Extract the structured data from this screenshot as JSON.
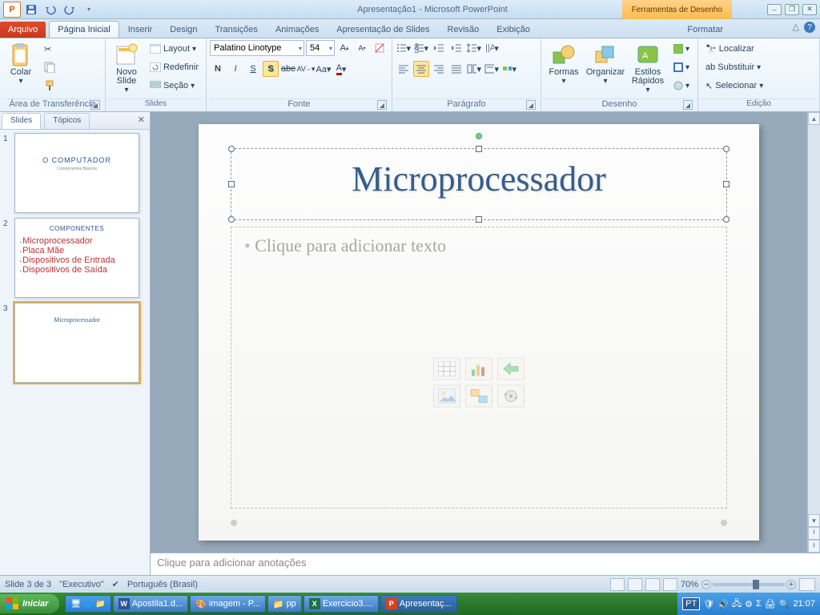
{
  "app": {
    "title": "Apresentação1 - Microsoft PowerPoint",
    "context_tab": "Ferramentas de Desenho",
    "context_subtab": "Formatar"
  },
  "qat": {
    "app_initial": "P"
  },
  "tabs": {
    "file": "Arquivo",
    "items": [
      "Página Inicial",
      "Inserir",
      "Design",
      "Transições",
      "Animações",
      "Apresentação de Slides",
      "Revisão",
      "Exibição"
    ],
    "active": 0
  },
  "ribbon": {
    "clipboard": {
      "label": "Área de Transferência",
      "paste": "Colar"
    },
    "slides": {
      "label": "Slides",
      "new_slide": "Novo Slide",
      "layout": "Layout",
      "reset": "Redefinir",
      "section": "Seção"
    },
    "font": {
      "label": "Fonte",
      "name": "Palatino Linotype",
      "size": "54"
    },
    "paragraph": {
      "label": "Parágrafo"
    },
    "drawing": {
      "label": "Desenho",
      "shapes": "Formas",
      "arrange": "Organizar",
      "quick_styles": "Estilos Rápidos"
    },
    "editing": {
      "label": "Edição",
      "find": "Localizar",
      "replace": "Substituir",
      "select": "Selecionar"
    }
  },
  "panel": {
    "tabs": [
      "Slides",
      "Tópicos"
    ],
    "thumbs": [
      {
        "n": "1",
        "title": "O COMPUTADOR",
        "sub": "Componentes Básicos"
      },
      {
        "n": "2",
        "title": "COMPONENTES",
        "bullets": [
          "Microprocessador",
          "Placa Mãe",
          "Dispositivos de Entrada",
          "Dispositivos de Saída"
        ]
      },
      {
        "n": "3",
        "title": "Microprocessador"
      }
    ]
  },
  "slide": {
    "title": "Microprocessador",
    "body_placeholder": "Clique para adicionar texto"
  },
  "notes_placeholder": "Clique para adicionar anotações",
  "status": {
    "slide_info": "Slide 3 de 3",
    "theme": "\"Executivo\"",
    "language": "Português (Brasil)",
    "zoom": "70%"
  },
  "taskbar": {
    "start": "Iniciar",
    "items": [
      "Apostila1.d...",
      "imagem - P...",
      "pp",
      "Exercicio3....",
      "Apresentaç..."
    ],
    "lang": "PT",
    "clock": "21:07"
  }
}
